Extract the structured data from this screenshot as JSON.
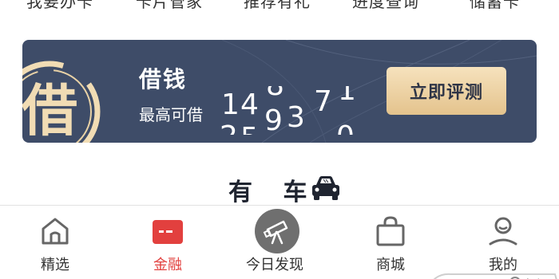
{
  "quick_actions": [
    {
      "label": "我要办卡"
    },
    {
      "label": "卡片管家"
    },
    {
      "label": "推荐有礼"
    },
    {
      "label": "进度查询"
    },
    {
      "label": "储蓄卡"
    }
  ],
  "loan_banner": {
    "seal_char": "借",
    "title": "借钱",
    "subtitle": "最高可借",
    "cta_label": "立即评测",
    "bg_color": "#3e4c68",
    "accent_color": "#f1dcb4"
  },
  "section": {
    "title": "有 车",
    "icon": "car-icon"
  },
  "tabbar": {
    "active_color": "#e2403e",
    "tabs": [
      {
        "label": "精选",
        "icon": "home-icon"
      },
      {
        "label": "金融",
        "icon": "card-icon",
        "active": true
      },
      {
        "label": "今日发现",
        "icon": "telescope-icon"
      },
      {
        "label": "商城",
        "icon": "shopping-bag-icon"
      },
      {
        "label": "我的",
        "icon": "user-icon"
      }
    ]
  }
}
